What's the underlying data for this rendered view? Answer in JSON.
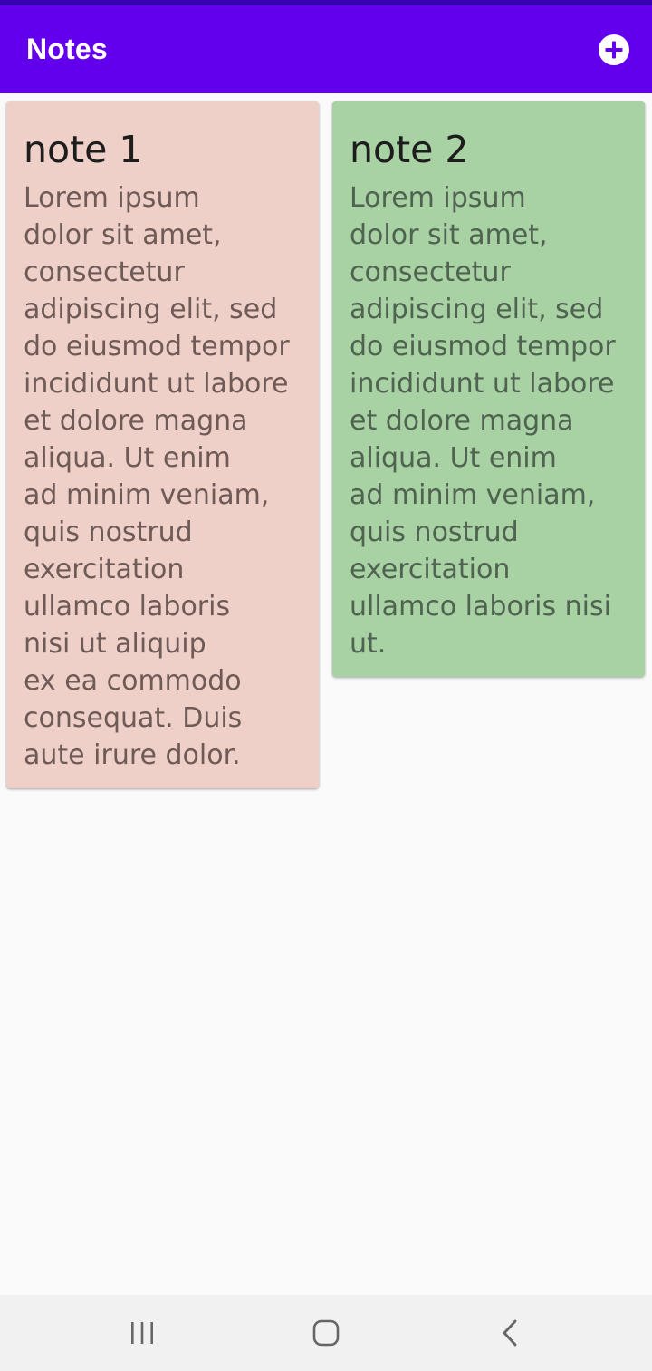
{
  "app_bar": {
    "title": "Notes",
    "add_icon": "add-circle-icon",
    "background": "#6200ee",
    "status_strip": "#3700b3"
  },
  "notes": [
    {
      "title": "note 1",
      "body": "Lorem ipsum\ndolor sit amet,\nconsectetur\nadipiscing elit, sed\ndo eiusmod tempor\nincididunt ut labore\net dolore magna\naliqua. Ut enim\nad minim veniam,\nquis nostrud\nexercitation\nullamco laboris\nnisi ut aliquip\nex ea commodo\nconsequat. Duis\naute irure dolor.",
      "color": "#efd0c8"
    },
    {
      "title": "note 2",
      "body": "Lorem ipsum\ndolor sit amet,\nconsectetur\nadipiscing elit, sed\ndo eiusmod tempor\nincididunt ut labore\net dolore magna\naliqua. Ut enim\nad minim veniam,\nquis nostrud\nexercitation\nullamco laboris nisi\nut.",
      "color": "#a8d1a4"
    }
  ],
  "nav_bar": {
    "recents_icon": "recents-icon",
    "home_icon": "home-icon",
    "back_icon": "back-icon"
  }
}
